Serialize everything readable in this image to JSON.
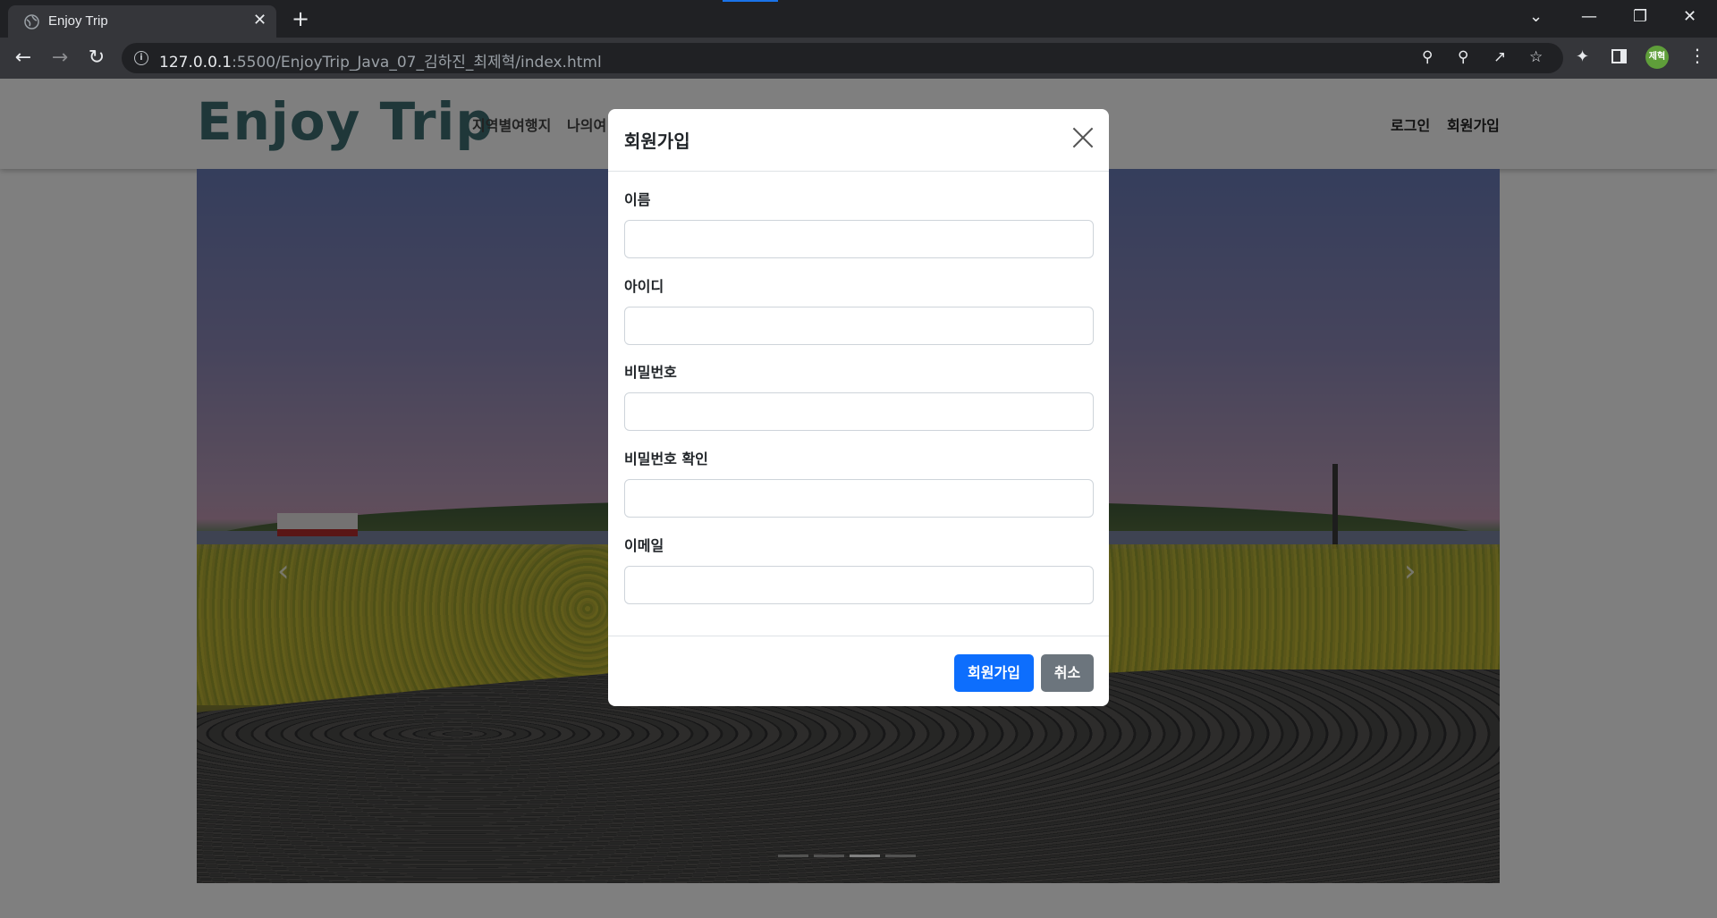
{
  "browser": {
    "tab_title": "Enjoy Trip",
    "tab_close": "✕",
    "new_tab": "+",
    "url_host": "127.0.0.1",
    "url_rest": ":5500/EnjoyTrip_Java_07_김하진_최제혁/index.html",
    "profile_initials": "제혁",
    "icons": [
      "globe-icon",
      "back-icon",
      "forward-icon",
      "reload-icon",
      "info-icon",
      "key-icon",
      "zoom-icon",
      "share-icon",
      "star-icon",
      "extensions-icon",
      "side-panel-icon",
      "menu-icon"
    ]
  },
  "header": {
    "logo": "Enjoy Trip",
    "nav": [
      "지역별여행지",
      "나의여"
    ],
    "auth": [
      "로그인",
      "회원가입"
    ]
  },
  "carousel": {
    "prev": "‹",
    "next": "›",
    "slide_count": 4,
    "active_index": 2
  },
  "modal": {
    "title": "회원가입",
    "fields": [
      {
        "label": "이름",
        "value": ""
      },
      {
        "label": "아이디",
        "value": ""
      },
      {
        "label": "비밀번호",
        "value": ""
      },
      {
        "label": "비밀번호 확인",
        "value": ""
      },
      {
        "label": "이메일",
        "value": ""
      }
    ],
    "submit_label": "회원가입",
    "cancel_label": "취소"
  },
  "colors": {
    "primary": "#0d6efd",
    "secondary": "#6c757d",
    "logo": "#3e6f73",
    "profile": "#5f9e3a"
  }
}
